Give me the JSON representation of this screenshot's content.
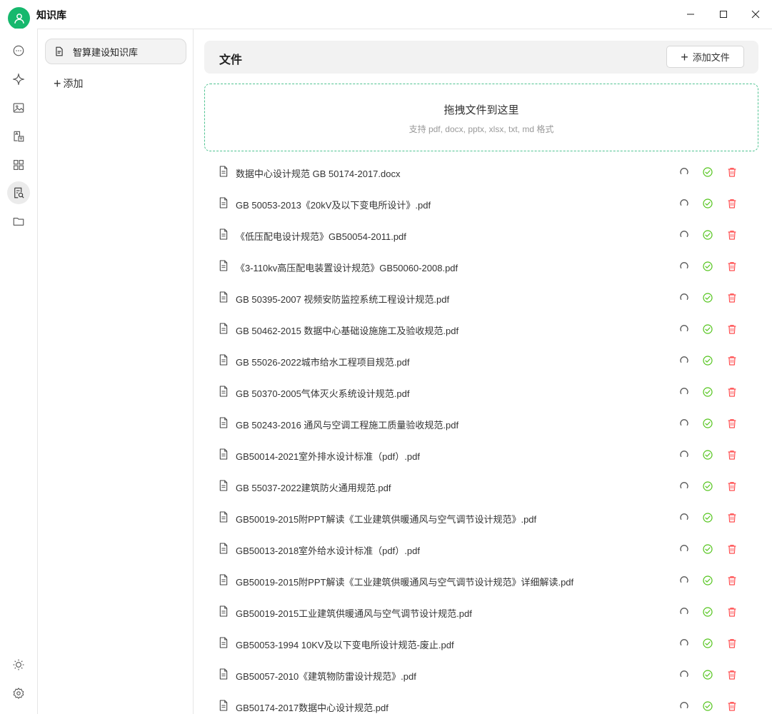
{
  "app": {
    "title": "知识库"
  },
  "window_controls": [
    "minimize",
    "maximize",
    "close"
  ],
  "rail": {
    "items": [
      {
        "name": "chat",
        "icon": "chat-bubble-icon"
      },
      {
        "name": "assistant",
        "icon": "sparkle-icon"
      },
      {
        "name": "image",
        "icon": "image-icon"
      },
      {
        "name": "translate",
        "icon": "translate-icon"
      },
      {
        "name": "apps",
        "icon": "apps-grid-icon"
      },
      {
        "name": "knowledge",
        "icon": "knowledge-search-icon",
        "active": true
      },
      {
        "name": "files",
        "icon": "folder-icon"
      }
    ],
    "bottom": [
      {
        "name": "theme",
        "icon": "sun-icon"
      },
      {
        "name": "settings",
        "icon": "gear-icon"
      }
    ]
  },
  "knowledge_bases": {
    "items": [
      {
        "label": "智算建设知识库",
        "selected": true
      }
    ],
    "add_label": "添加"
  },
  "files": {
    "title": "文件",
    "add_button": "添加文件",
    "dropzone": {
      "title": "拖拽文件到这里",
      "hint": "支持 pdf, docx, pptx, xlsx, txt, md 格式"
    },
    "items": [
      {
        "name": "数据中心设计规范 GB 50174-2017.docx"
      },
      {
        "name": "GB 50053-2013《20kV及以下变电所设计》.pdf"
      },
      {
        "name": "《低压配电设计规范》GB50054-2011.pdf"
      },
      {
        "name": "《3-110kv高压配电装置设计规范》GB50060-2008.pdf"
      },
      {
        "name": "GB 50395-2007 视频安防监控系统工程设计规范.pdf"
      },
      {
        "name": "GB 50462-2015 数据中心基础设施施工及验收规范.pdf"
      },
      {
        "name": "GB 55026-2022城市给水工程项目规范.pdf"
      },
      {
        "name": "GB 50370-2005气体灭火系统设计规范.pdf"
      },
      {
        "name": "GB 50243-2016 通风与空调工程施工质量验收规范.pdf"
      },
      {
        "name": "GB50014-2021室外排水设计标准（pdf）.pdf"
      },
      {
        "name": "GB 55037-2022建筑防火通用规范.pdf"
      },
      {
        "name": "GB50019-2015附PPT解读《工业建筑供暖通风与空气调节设计规范》.pdf"
      },
      {
        "name": "GB50013-2018室外给水设计标准（pdf）.pdf"
      },
      {
        "name": "GB50019-2015附PPT解读《工业建筑供暖通风与空气调节设计规范》详细解读.pdf"
      },
      {
        "name": "GB50019-2015工业建筑供暖通风与空气调节设计规范.pdf"
      },
      {
        "name": "GB50053-1994 10KV及以下变电所设计规范-废止.pdf"
      },
      {
        "name": "GB50057-2010《建筑物防雷设计规范》.pdf"
      },
      {
        "name": "GB50174-2017数据中心设计规范.pdf"
      }
    ],
    "row_actions": [
      "refresh-icon",
      "check-circle-icon",
      "trash-icon"
    ],
    "colors": {
      "check": "#52c41a",
      "delete": "#ff4d4f",
      "refresh": "#555555",
      "accent": "#16b86d"
    }
  }
}
